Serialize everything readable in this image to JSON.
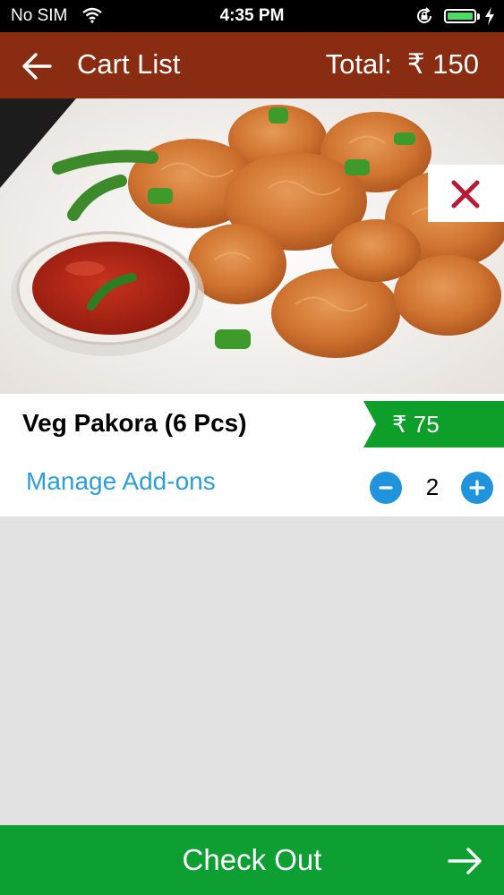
{
  "status_bar": {
    "carrier": "No SIM",
    "time": "4:35 PM",
    "icons": [
      "wifi-icon",
      "rotation-lock-icon",
      "battery-icon",
      "charging-bolt-icon"
    ],
    "battery_color": "#4cd964"
  },
  "header": {
    "title": "Cart List",
    "total": "Total:  ₹ 150",
    "background": "#8a2c12",
    "back_icon": "arrow-left-icon"
  },
  "cart": {
    "items": [
      {
        "image": "veg-pakora-photo",
        "remove_icon": "close-icon",
        "name": "Veg Pakora (6 Pcs)",
        "price": "₹ 75",
        "manage_addons_label": "Manage Add-ons",
        "quantity": "2",
        "price_tag_color": "#0e9f2b",
        "accent_color": "#2e9ed6"
      }
    ]
  },
  "checkout": {
    "label": "Check Out",
    "icon": "arrow-right-icon",
    "background": "#0d9f32"
  }
}
